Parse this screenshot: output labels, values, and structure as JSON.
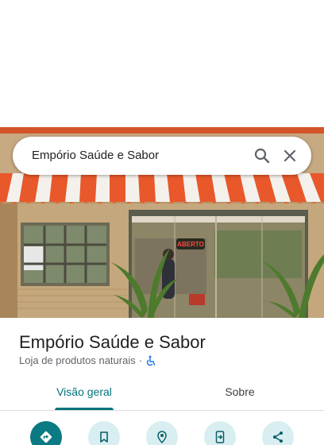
{
  "search": {
    "query": "Empório Saúde e Sabor"
  },
  "place": {
    "name": "Empório Saúde e Sabor",
    "category": "Loja de produtos naturais",
    "separator": "·"
  },
  "photo": {
    "sign_text": "ABERTO"
  },
  "tabs": [
    {
      "label": "Visão geral",
      "active": true
    },
    {
      "label": "Sobre",
      "active": false
    }
  ],
  "actions": [
    {
      "icon": "directions-icon"
    },
    {
      "icon": "bookmark-icon"
    },
    {
      "icon": "nearby-icon"
    },
    {
      "icon": "send-to-phone-icon"
    },
    {
      "icon": "share-icon"
    }
  ],
  "colors": {
    "accent": "#00737a",
    "primary_action": "#0b7a82",
    "action_bg": "#d8eef1",
    "awning_orange": "#e8582a",
    "accessibility_blue": "#1a73e8"
  }
}
